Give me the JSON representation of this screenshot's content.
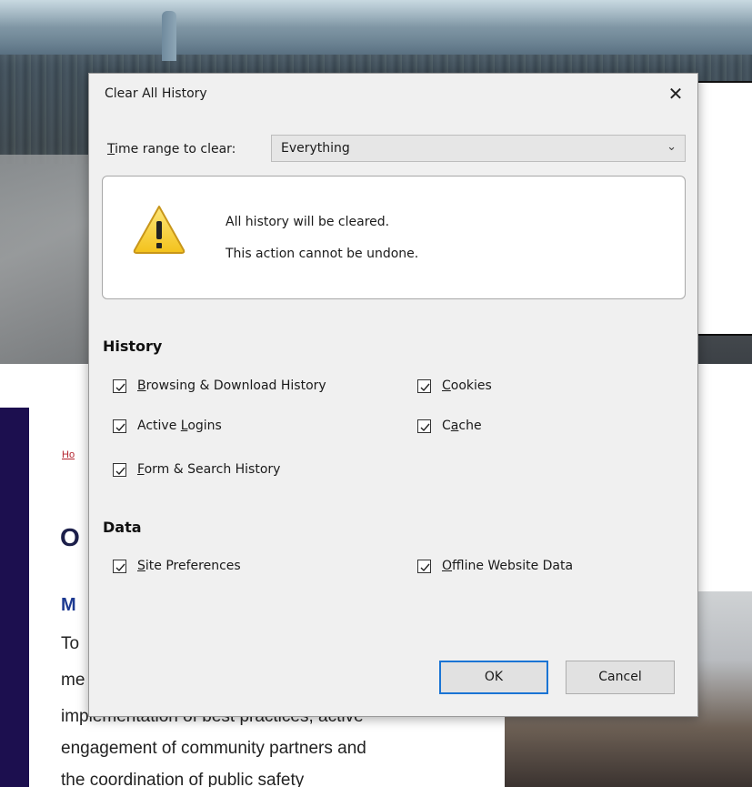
{
  "background_page": {
    "breadcrumb": "Ho",
    "heading": "O",
    "subheading": "M",
    "paragraph_lines": [
      "To",
      "me",
      "implementation of best practices, active",
      "engagement of community partners and",
      "the coordination of public safety"
    ]
  },
  "dialog": {
    "title": "Clear All History",
    "close_glyph": "✕",
    "time_range": {
      "label_prefix": "T",
      "label_rest": "ime range to clear:",
      "selected": "Everything",
      "chevron": "⌄"
    },
    "warning": {
      "line1": "All history will be cleared.",
      "line2": "This action cannot be undone."
    },
    "history_section": {
      "heading": "History",
      "items": [
        {
          "label_pre": "",
          "label_u": "B",
          "label_post": "rowsing & Download History",
          "checked": true
        },
        {
          "label_pre": "",
          "label_u": "C",
          "label_post": "ookies",
          "checked": true
        },
        {
          "label_pre": "Active ",
          "label_u": "L",
          "label_post": "ogins",
          "checked": true
        },
        {
          "label_pre": "C",
          "label_u": "a",
          "label_post": "che",
          "checked": true
        },
        {
          "label_pre": "",
          "label_u": "F",
          "label_post": "orm & Search History",
          "checked": true
        }
      ]
    },
    "data_section": {
      "heading": "Data",
      "items": [
        {
          "label_pre": "",
          "label_u": "S",
          "label_post": "ite Preferences",
          "checked": true
        },
        {
          "label_pre": "",
          "label_u": "O",
          "label_post": "ffline Website Data",
          "checked": true
        }
      ]
    },
    "buttons": {
      "ok": "OK",
      "cancel": "Cancel"
    }
  }
}
